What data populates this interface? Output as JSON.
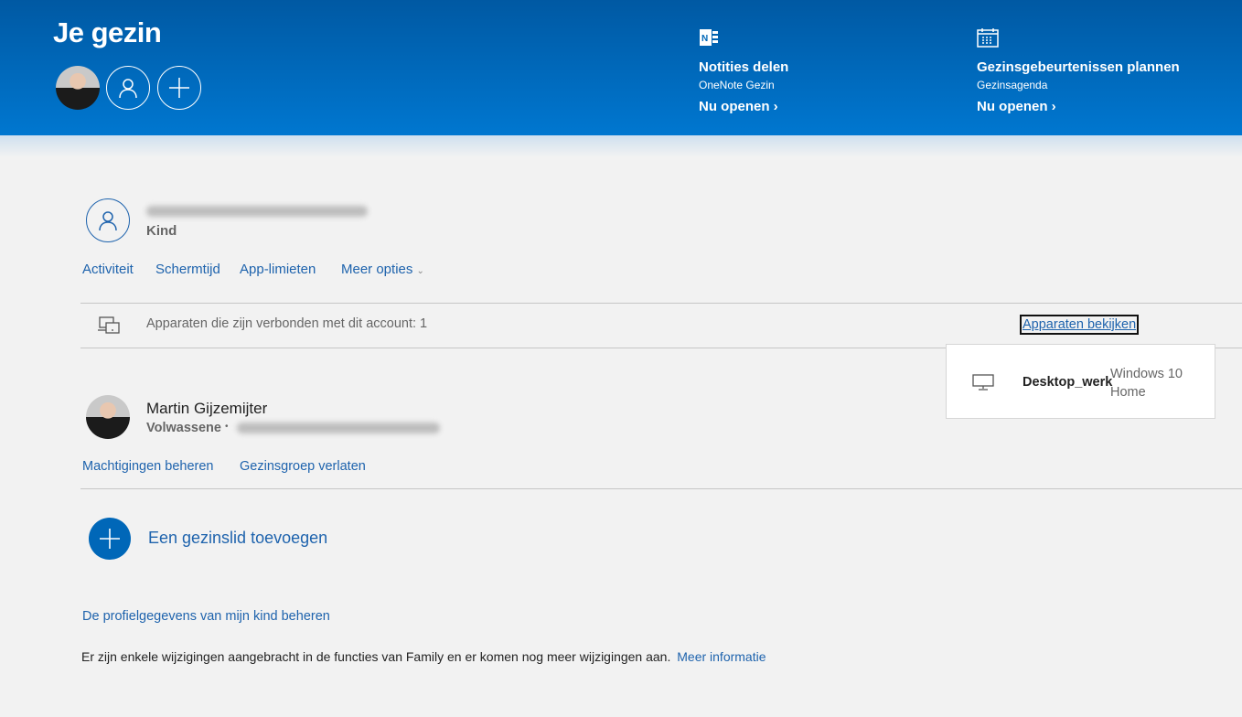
{
  "header": {
    "title": "Je gezin",
    "promos": [
      {
        "icon": "onenote-icon",
        "heading": "Notities delen",
        "sub": "OneNote Gezin",
        "link": "Nu openen ›"
      },
      {
        "icon": "calendar-icon",
        "heading": "Gezinsgebeurtenissen plannen",
        "sub": "Gezinsagenda",
        "link": "Nu openen ›"
      }
    ]
  },
  "child": {
    "role": "Kind",
    "links": [
      "Activiteit",
      "Schermtijd",
      "App-limieten",
      "Meer opties"
    ],
    "devices_text": "Apparaten die zijn verbonden met dit account: 1",
    "devices_link": "Apparaten bekijken"
  },
  "device_popup": {
    "name": "Desktop_werk",
    "os": "Windows 10 Home"
  },
  "adult": {
    "name": "Martin Gijzemijter",
    "role": "Volwassene",
    "separator": "•",
    "links": [
      "Machtigingen beheren",
      "Gezinsgroep verlaten"
    ]
  },
  "add_member": "Een gezinslid toevoegen",
  "manage_profile": "De profielgegevens van mijn kind beheren",
  "notice": {
    "text": "Er zijn enkele wijzigingen aangebracht in de functies van Family en er komen nog meer wijzigingen aan.",
    "link": "Meer informatie"
  },
  "colors": {
    "accent": "#0067b8",
    "link": "#1e63ad"
  }
}
